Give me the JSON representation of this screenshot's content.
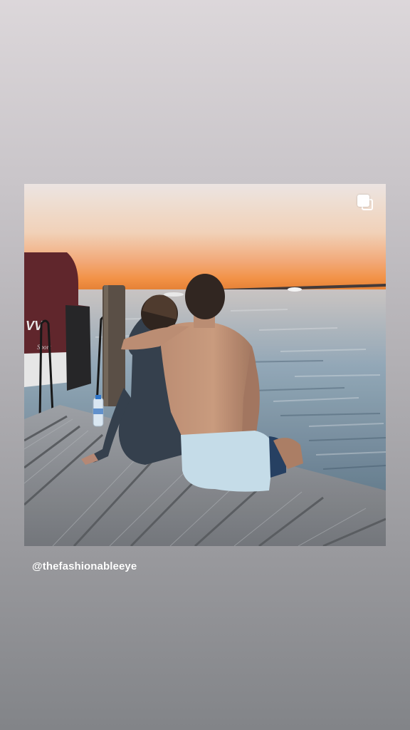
{
  "post": {
    "image_description_icon": "photo",
    "multi_icon": "multiple-photos-icon",
    "caption": "@thefashionableeye",
    "boat_hull_text": "VV",
    "boat_sport_text": "Sport"
  },
  "colors": {
    "background_top": "#dcd7da",
    "background_bottom": "#828488",
    "caption": "#ffffff"
  }
}
